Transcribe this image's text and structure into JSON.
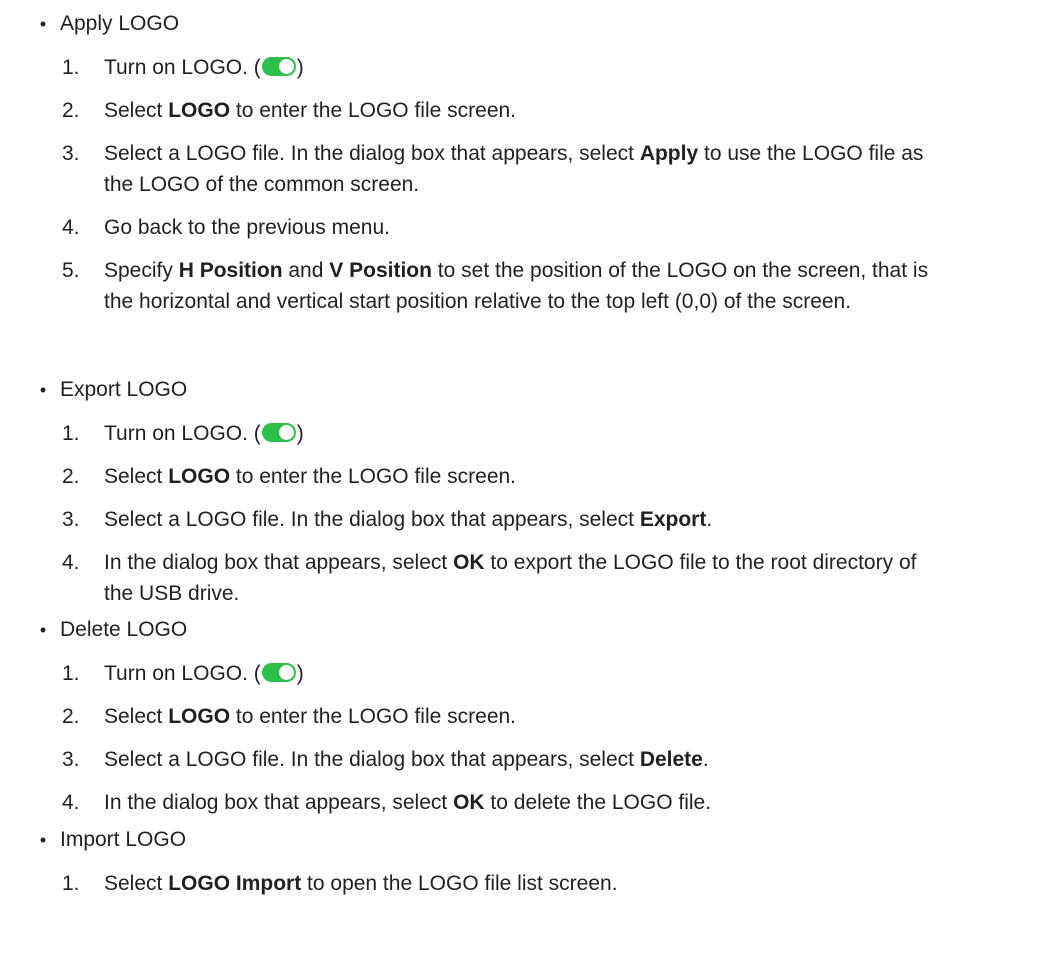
{
  "bullet_glyph": "•",
  "toggle": {
    "icon": "toggle-on-icon",
    "track_color": "#2cc04a",
    "knob_color": "#ffffff",
    "state": "on"
  },
  "sections": [
    {
      "title": "Apply LOGO",
      "steps": [
        {
          "num": "1.",
          "parts": [
            {
              "t": "Turn on LOGO. ("
            },
            {
              "toggle": true
            },
            {
              "t": ")"
            }
          ]
        },
        {
          "num": "2.",
          "parts": [
            {
              "t": "Select "
            },
            {
              "b": "LOGO"
            },
            {
              "t": " to enter the LOGO file screen."
            }
          ]
        },
        {
          "num": "3.",
          "parts": [
            {
              "t": "Select a LOGO file. In the dialog box that appears, select "
            },
            {
              "b": "Apply"
            },
            {
              "t": " to use the LOGO file as the LOGO of the common screen."
            }
          ]
        },
        {
          "num": "4.",
          "parts": [
            {
              "t": "Go back to the previous menu."
            }
          ]
        },
        {
          "num": "5.",
          "parts": [
            {
              "t": "Specify "
            },
            {
              "b": "H Position"
            },
            {
              "t": " and "
            },
            {
              "b": "V Position"
            },
            {
              "t": " to set the position of the LOGO on the screen, that is the horizontal and vertical start position relative to the top left (0,0) of the screen."
            }
          ]
        }
      ]
    },
    {
      "title": "Export LOGO",
      "steps": [
        {
          "num": "1.",
          "parts": [
            {
              "t": "Turn on LOGO. ("
            },
            {
              "toggle": true
            },
            {
              "t": ")"
            }
          ]
        },
        {
          "num": "2.",
          "parts": [
            {
              "t": "Select "
            },
            {
              "b": "LOGO"
            },
            {
              "t": " to enter the LOGO file screen."
            }
          ]
        },
        {
          "num": "3.",
          "parts": [
            {
              "t": "Select a LOGO file. In the dialog box that appears, select "
            },
            {
              "b": "Export"
            },
            {
              "t": "."
            }
          ]
        },
        {
          "num": "4.",
          "parts": [
            {
              "t": "In the dialog box that appears, select "
            },
            {
              "b": "OK"
            },
            {
              "t": " to export the LOGO file to the root directory of the USB drive."
            }
          ]
        }
      ]
    },
    {
      "title": "Delete LOGO",
      "steps": [
        {
          "num": "1.",
          "parts": [
            {
              "t": "Turn on LOGO. ("
            },
            {
              "toggle": true
            },
            {
              "t": ")"
            }
          ]
        },
        {
          "num": "2.",
          "parts": [
            {
              "t": "Select "
            },
            {
              "b": "LOGO"
            },
            {
              "t": " to enter the LOGO file screen."
            }
          ]
        },
        {
          "num": "3.",
          "parts": [
            {
              "t": "Select a LOGO file. In the dialog box that appears, select "
            },
            {
              "b": "Delete"
            },
            {
              "t": "."
            }
          ]
        },
        {
          "num": "4.",
          "parts": [
            {
              "t": "In the dialog box that appears, select "
            },
            {
              "b": "OK"
            },
            {
              "t": " to delete the LOGO file."
            }
          ]
        }
      ]
    },
    {
      "title": "Import LOGO",
      "steps": [
        {
          "num": "1.",
          "parts": [
            {
              "t": "Select "
            },
            {
              "b": "LOGO Import"
            },
            {
              "t": " to open the LOGO file list screen."
            }
          ]
        }
      ]
    }
  ]
}
